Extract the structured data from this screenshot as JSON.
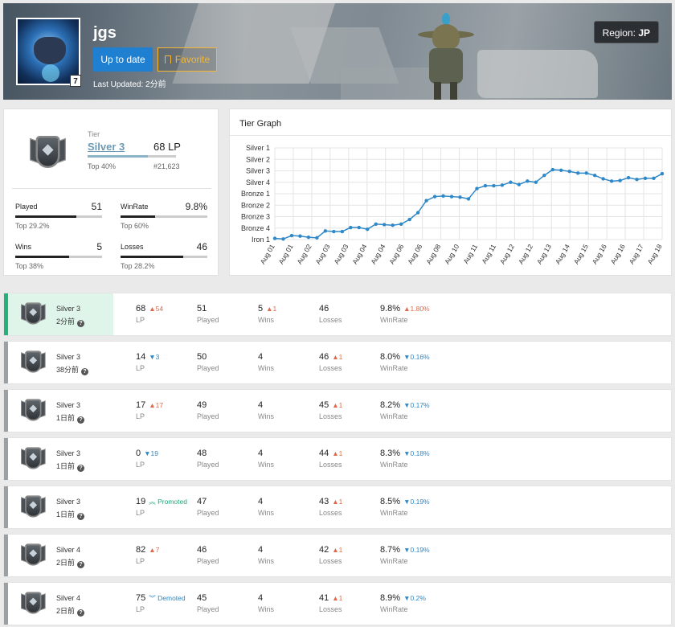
{
  "header": {
    "summoner_name": "jgs",
    "level": "7",
    "update_button": "Up to date",
    "favorite_button": "Favorite",
    "last_updated": "Last Updated: 2分前",
    "region_label": "Region:",
    "region_value": "JP"
  },
  "tier_card": {
    "label": "Tier",
    "tier": "Silver 3",
    "lp": "68 LP",
    "progress": 0.68,
    "top": "Top 40%",
    "rank": "#21,623",
    "stats": [
      {
        "label": "Played",
        "value": "51",
        "top": "Top 29.2%",
        "fill": 0.7
      },
      {
        "label": "WinRate",
        "value": "9.8%",
        "top": "Top 60%",
        "fill": 0.4
      },
      {
        "label": "Wins",
        "value": "5",
        "top": "Top 38%",
        "fill": 0.62
      },
      {
        "label": "Losses",
        "value": "46",
        "top": "Top 28.2%",
        "fill": 0.72
      }
    ]
  },
  "graph": {
    "title": "Tier Graph"
  },
  "chart_data": {
    "type": "line",
    "title": "Tier Graph",
    "y_ticks": [
      "Iron 1",
      "Bronze 4",
      "Bronze 3",
      "Bronze 2",
      "Bronze 1",
      "Silver 4",
      "Silver 3",
      "Silver 2",
      "Silver 1"
    ],
    "x_labels": [
      "Aug 01",
      "Aug 01",
      "Aug 02",
      "Aug 03",
      "Aug 03",
      "Aug 04",
      "Aug 04",
      "Aug 06",
      "Aug 06",
      "Aug 08",
      "Aug 10",
      "Aug 11",
      "Aug 11",
      "Aug 12",
      "Aug 12",
      "Aug 13",
      "Aug 14",
      "Aug 15",
      "Aug 16",
      "Aug 16",
      "Aug 17",
      "Aug 18"
    ],
    "ylim": [
      0,
      8
    ],
    "series": [
      {
        "values": [
          0.1,
          0.05,
          0.35,
          0.3,
          0.2,
          0.15,
          0.75,
          0.7,
          0.7,
          1.05,
          1.05,
          0.9,
          1.35,
          1.3,
          1.25,
          1.35,
          1.75,
          2.35,
          3.4,
          3.75,
          3.8,
          3.75,
          3.7,
          3.55,
          4.45,
          4.7,
          4.7,
          4.75,
          5.0,
          4.8,
          5.1,
          5.0,
          5.6,
          6.1,
          6.05,
          5.95,
          5.8,
          5.8,
          5.6,
          5.3,
          5.1,
          5.15,
          5.4,
          5.25,
          5.35,
          5.35,
          5.75
        ]
      }
    ],
    "line_color": "#2f88c8"
  },
  "history": [
    {
      "tier": "Silver 3",
      "time": "2分前",
      "lp": "68",
      "lp_delta": "54",
      "lp_dir": "up",
      "played": "51",
      "wins": "5",
      "wins_delta": "1",
      "losses": "46",
      "losses_delta": "",
      "winrate": "9.8%",
      "wr_delta": "1.80%",
      "wr_dir": "up",
      "current": true
    },
    {
      "tier": "Silver 3",
      "time": "38分前",
      "lp": "14",
      "lp_delta": "3",
      "lp_dir": "down",
      "played": "50",
      "wins": "4",
      "wins_delta": "",
      "losses": "46",
      "losses_delta": "1",
      "winrate": "8.0%",
      "wr_delta": "0.16%",
      "wr_dir": "down",
      "current": false
    },
    {
      "tier": "Silver 3",
      "time": "1日前",
      "lp": "17",
      "lp_delta": "17",
      "lp_dir": "up",
      "played": "49",
      "wins": "4",
      "wins_delta": "",
      "losses": "45",
      "losses_delta": "1",
      "winrate": "8.2%",
      "wr_delta": "0.17%",
      "wr_dir": "down",
      "current": false
    },
    {
      "tier": "Silver 3",
      "time": "1日前",
      "lp": "0",
      "lp_delta": "19",
      "lp_dir": "down",
      "played": "48",
      "wins": "4",
      "wins_delta": "",
      "losses": "44",
      "losses_delta": "1",
      "winrate": "8.3%",
      "wr_delta": "0.18%",
      "wr_dir": "down",
      "current": false
    },
    {
      "tier": "Silver 3",
      "time": "1日前",
      "lp": "19",
      "lp_delta": "Promoted",
      "lp_dir": "promo",
      "played": "47",
      "wins": "4",
      "wins_delta": "",
      "losses": "43",
      "losses_delta": "1",
      "winrate": "8.5%",
      "wr_delta": "0.19%",
      "wr_dir": "down",
      "current": false
    },
    {
      "tier": "Silver 4",
      "time": "2日前",
      "lp": "82",
      "lp_delta": "7",
      "lp_dir": "up",
      "played": "46",
      "wins": "4",
      "wins_delta": "",
      "losses": "42",
      "losses_delta": "1",
      "winrate": "8.7%",
      "wr_delta": "0.19%",
      "wr_dir": "down",
      "current": false
    },
    {
      "tier": "Silver 4",
      "time": "2日前",
      "lp": "75",
      "lp_delta": "Demoted",
      "lp_dir": "demo",
      "played": "45",
      "wins": "4",
      "wins_delta": "",
      "losses": "41",
      "losses_delta": "1",
      "winrate": "8.9%",
      "wr_delta": "0.2%",
      "wr_dir": "down",
      "current": false
    }
  ],
  "labels": {
    "lp": "LP",
    "played": "Played",
    "wins": "Wins",
    "losses": "Losses",
    "winrate": "WinRate"
  }
}
